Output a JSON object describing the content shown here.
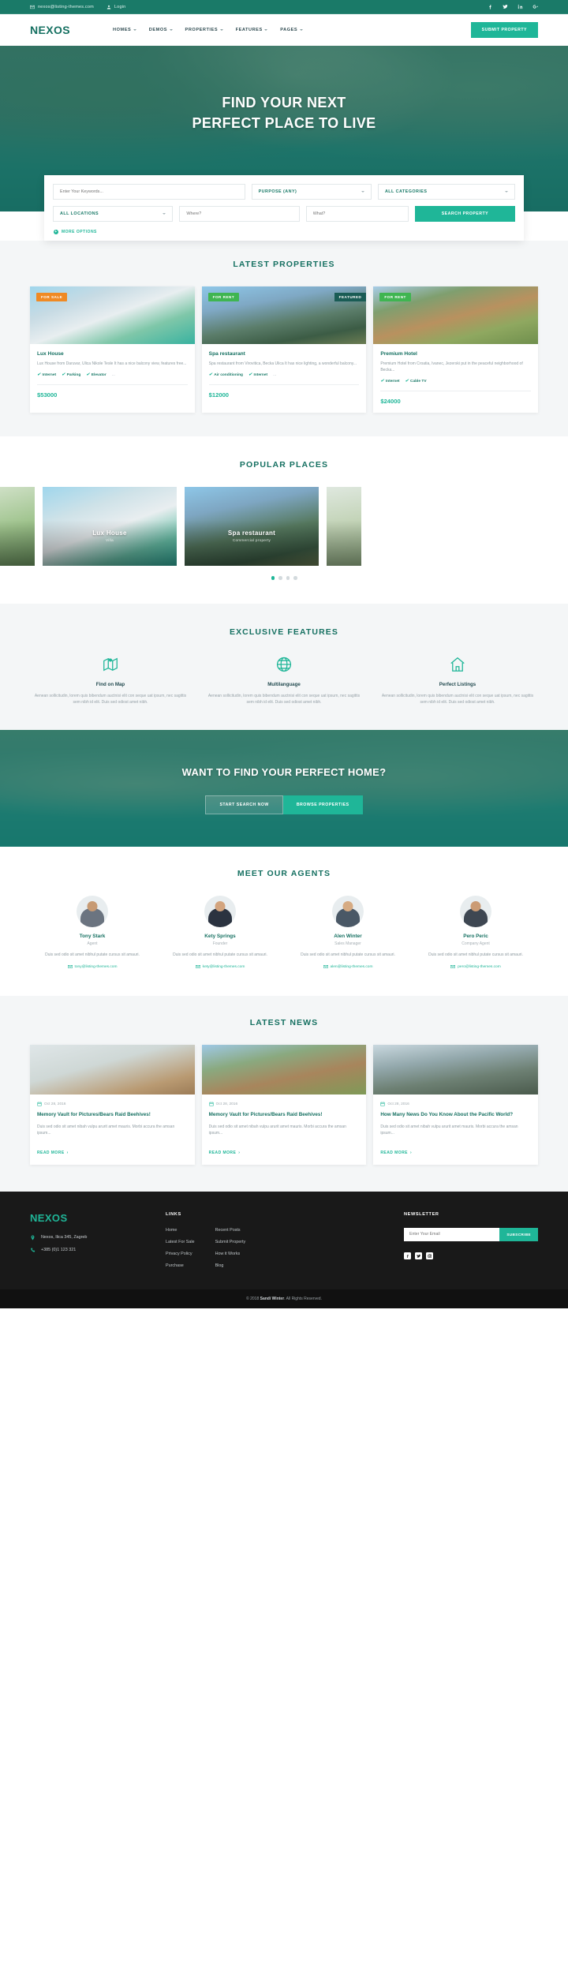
{
  "topbar": {
    "email": "nexos@listing-themes.com",
    "email_icon": "envelope-icon",
    "login": "Login",
    "login_icon": "user-icon",
    "socials": [
      "facebook-icon",
      "twitter-icon",
      "linkedin-icon",
      "google-plus-icon"
    ]
  },
  "nav": {
    "brand": "NEXOS",
    "items": [
      {
        "label": "HOMES"
      },
      {
        "label": "DEMOS"
      },
      {
        "label": "PROPERTIES"
      },
      {
        "label": "FEATURES"
      },
      {
        "label": "PAGES"
      }
    ],
    "cta": "SUBMIT PROPERTY"
  },
  "hero": {
    "title_line1": "FIND YOUR NEXT",
    "title_line2": "PERFECT PLACE TO LIVE"
  },
  "search": {
    "keywords_placeholder": "Enter Your Keywords...",
    "purpose": "PURPOSE (ANY)",
    "categories": "ALL CATEGORIES",
    "locations": "ALL LOCATIONS",
    "where_placeholder": "Where?",
    "what_placeholder": "What?",
    "submit": "SEARCH PROPERTY",
    "more_options": "MORE OPTIONS"
  },
  "latest_properties": {
    "title": "LATEST PROPERTIES",
    "items": [
      {
        "badge": "FOR SALE",
        "badge_type": "sale",
        "featured": "",
        "name": "Lux House",
        "desc": "Lux House from Daruvar, Ulica Nikole Tesle It has a nice balcony view, features free...",
        "features": [
          "Internet",
          "Parking",
          "Elevator"
        ],
        "more": "...",
        "price": "$53000"
      },
      {
        "badge": "FOR RENT",
        "badge_type": "rent",
        "featured": "FEATURED",
        "name": "Spa restaurant",
        "desc": "Spa restaurant from Virovitica, Becka Ulica It has nice lighting, a wonderful balcony...",
        "features": [
          "Air conditioning",
          "Internet"
        ],
        "more": "...",
        "price": "$12000"
      },
      {
        "badge": "FOR RENT",
        "badge_type": "rent",
        "featured": "",
        "name": "Premium Hotel",
        "desc": "Premium Hotel from Croatia, Ivanec, Jezerski put in the peaceful neighborhood of Becka...",
        "features": [
          "Internet",
          "Cable TV"
        ],
        "more": "",
        "price": "$24000"
      }
    ]
  },
  "popular_places": {
    "title": "POPULAR PLACES",
    "items": [
      {
        "name": "",
        "sub": ""
      },
      {
        "name": "Lux House",
        "sub": "Villa"
      },
      {
        "name": "Spa restaurant",
        "sub": "Commercial property"
      },
      {
        "name": "",
        "sub": ""
      }
    ],
    "dots": 4,
    "active_dot": 0
  },
  "exclusive_features": {
    "title": "EXCLUSIVE FEATURES",
    "items": [
      {
        "icon": "map-pin-icon",
        "heading": "Find on Map",
        "text": "Aenean sollicitudin, lorem quis bibendum auctnisi elit con seque uat ipsum, nec sagittis sem nibh id elit. Duis sed odiost amet nibh."
      },
      {
        "icon": "globe-icon",
        "heading": "Multilanguage",
        "text": "Aenean sollicitudin, lorem quis bibendum auctnisi elit con seque uat ipsum, nec sagittis sem nibh id elit. Duis sed odiost amet nibh."
      },
      {
        "icon": "home-icon",
        "heading": "Perfect Listings",
        "text": "Aenean sollicitudin, lorem quis bibendum auctnisi elit con seque uat ipsum, nec sagittis sem nibh id elit. Duis sed odiost amet nibh."
      }
    ]
  },
  "cta": {
    "title": "WANT TO FIND YOUR PERFECT HOME?",
    "primary": "START SEARCH NOW",
    "secondary": "BROWSE PROPERTIES"
  },
  "agents": {
    "title": "MEET OUR AGENTS",
    "items": [
      {
        "name": "Tony Stark",
        "role": "Agent",
        "desc": "Duis sed odio sit amet nibhul putate cursus sit amauri.",
        "email": "tony@listing-themes.com"
      },
      {
        "name": "Kety Springs",
        "role": "Founder",
        "desc": "Duis sed odio sit amet nibhul putate cursus sit amauri.",
        "email": "kety@listing-themes.com"
      },
      {
        "name": "Alen Winter",
        "role": "Sales Manager",
        "desc": "Duis sed odio sit amet nibhul putate cursus sit amauri.",
        "email": "alen@listing-themes.com"
      },
      {
        "name": "Pero Peric",
        "role": "Company Agent",
        "desc": "Duis sed odio sit amet nibhul putate cursus sit amauri.",
        "email": "pero@listing-themes.com"
      }
    ]
  },
  "news": {
    "title": "LATEST NEWS",
    "read_more": "READ MORE",
    "items": [
      {
        "date": "Oct 28, 2016",
        "title": "Memory Vault for Pictures/Bears Raid Beehives!",
        "excerpt": "Duis sed odio sit amet nibah vulpu arurit amet mauris. Morbi accura the amsan ipsum...",
        "date_icon": "calendar-icon"
      },
      {
        "date": "Oct 28, 2016",
        "title": "Memory Vault for Pictures/Bears Raid Beehives!",
        "excerpt": "Duis sed odio sit amet nibah vulpu arurit amet mauris. Morbi accura the amsan ipsum...",
        "date_icon": "calendar-icon"
      },
      {
        "date": "Oct 28, 2016",
        "title": "How Many News Do You Know About the Pacific World?",
        "excerpt": "Duis sed odio sit amet nibah vulpu arurit amet mauris. Morbi accura the amsan ipsum...",
        "date_icon": "calendar-icon"
      }
    ]
  },
  "footer": {
    "logo": "NEXOS",
    "address": "Nexos, Ilica 345, Zagreb",
    "address_icon": "location-pin-icon",
    "phone": "+385 (0)1 123 321",
    "phone_icon": "phone-icon",
    "links_heading": "LINKS",
    "links_col1": [
      "Home",
      "Latest For Sale",
      "Privacy Policy",
      "Purchase"
    ],
    "links_col2": [
      "Recent Posts",
      "Submit Property",
      "How it Works",
      "Blog"
    ],
    "newsletter_heading": "NEWSLETTER",
    "newsletter_placeholder": "Enter Your Email",
    "newsletter_button": "SUBSCRIBE",
    "socials": [
      "facebook-icon",
      "twitter-icon",
      "instagram-icon"
    ],
    "copyright_prefix": "© 2018 ",
    "copyright_brand": "Sandi Winter",
    "copyright_suffix": ". All Rights Reserved."
  },
  "colors": {
    "brand_dark": "#157061",
    "teal": "#1a7a68",
    "accent": "#1fb698",
    "orange": "#f08a24",
    "green": "#3fb551"
  }
}
